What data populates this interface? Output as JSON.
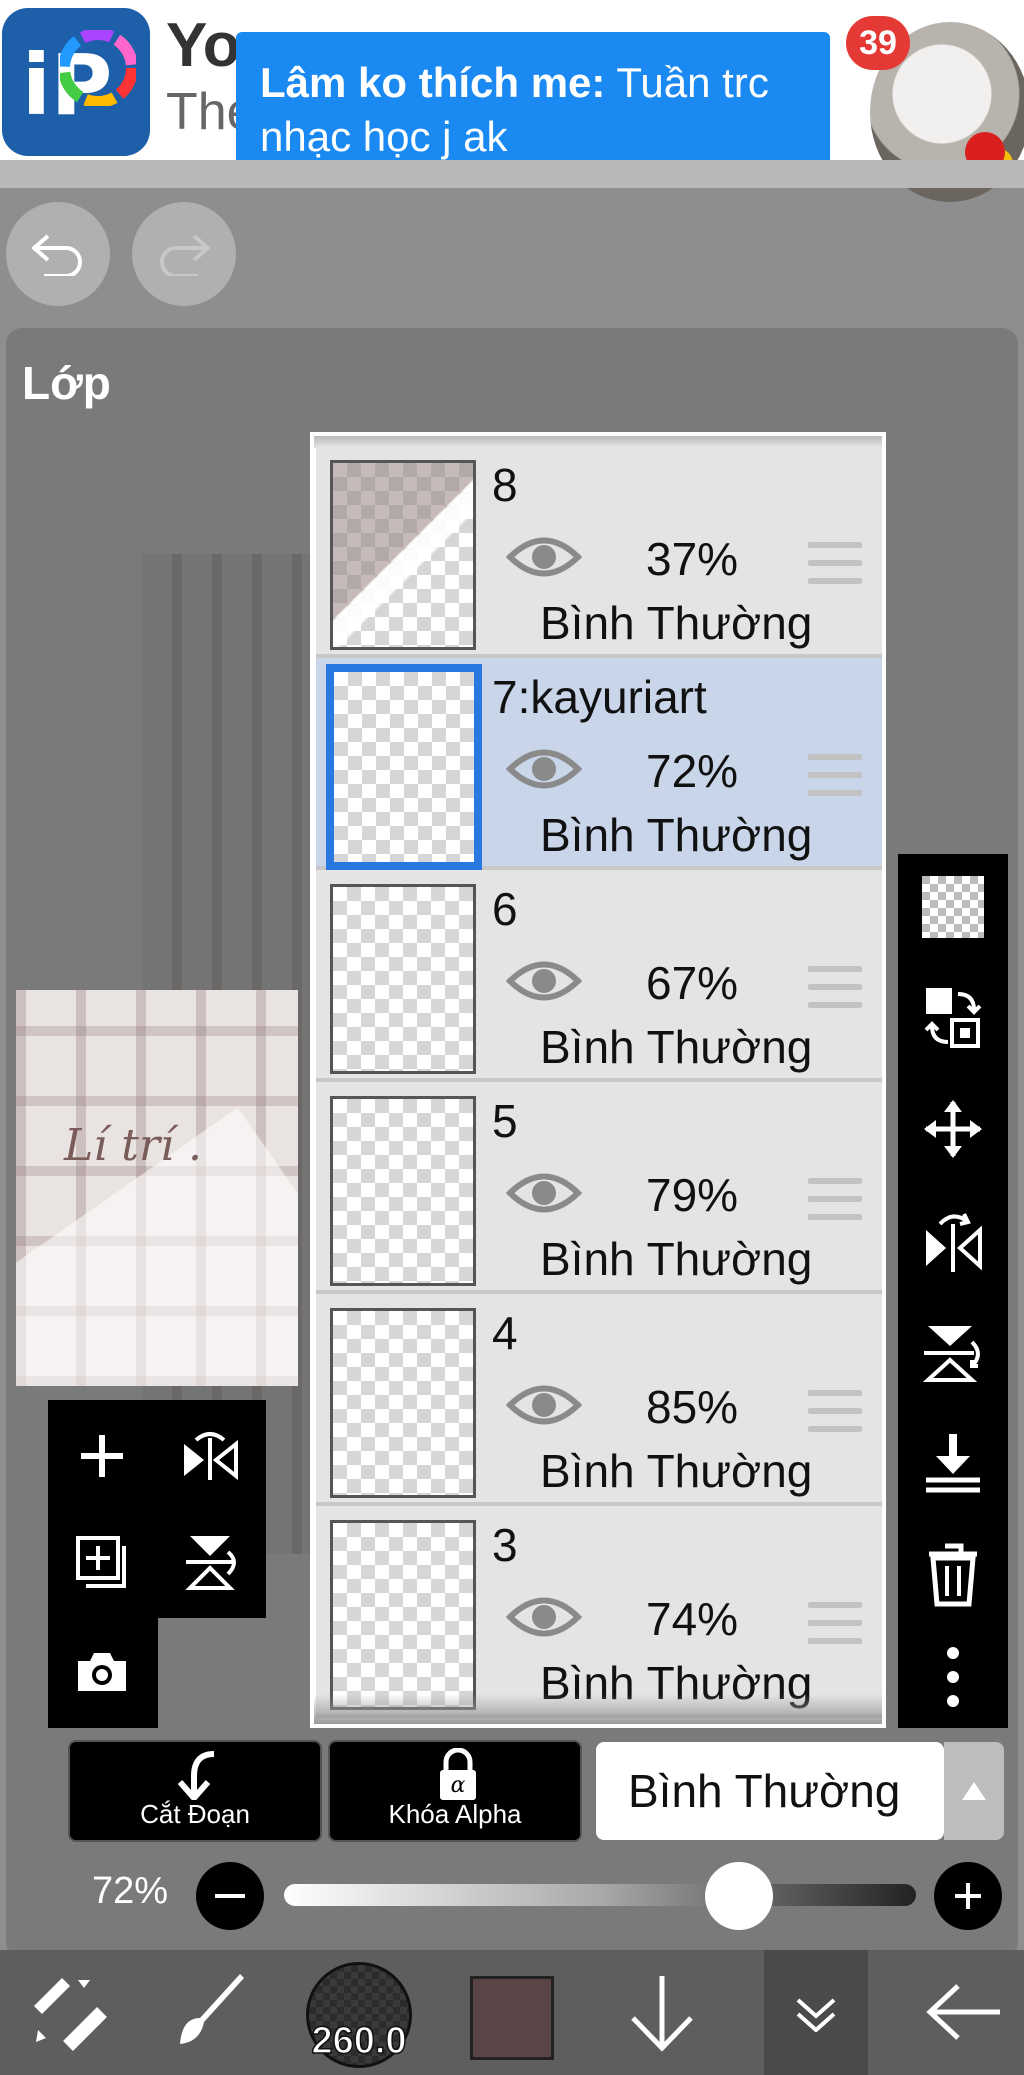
{
  "status_notification": {
    "sender": "Lâm ko thích me:",
    "message": "Tuần trc nhạc học j ak",
    "badge_count": "39"
  },
  "app_header": {
    "title": "Yo",
    "subtitle": "The"
  },
  "panel": {
    "title": "Lớp"
  },
  "layers": [
    {
      "name": "8",
      "opacity": "37%",
      "blend_mode": "Bình Thường",
      "selected": false
    },
    {
      "name": "7:kayuriart",
      "opacity": "72%",
      "blend_mode": "Bình Thường",
      "selected": true
    },
    {
      "name": "6",
      "opacity": "67%",
      "blend_mode": "Bình Thường",
      "selected": false
    },
    {
      "name": "5",
      "opacity": "79%",
      "blend_mode": "Bình Thường",
      "selected": false
    },
    {
      "name": "4",
      "opacity": "85%",
      "blend_mode": "Bình Thường",
      "selected": false
    },
    {
      "name": "3",
      "opacity": "74%",
      "blend_mode": "Bình Thường",
      "selected": false
    }
  ],
  "preview_text": "Lí trí .",
  "layer_actions": {
    "clipping_label": "Cắt Đoạn",
    "alpha_lock_label": "Khóa Alpha",
    "blend_mode_value": "Bình Thường"
  },
  "opacity": {
    "label": "72%",
    "value": 0.72
  },
  "bottom_bar": {
    "brush_size": "260.0",
    "color": "#5a4646"
  },
  "colors": {
    "notification_blue": "#1a8af2",
    "selected_layer": "#c9d6ea",
    "selected_border": "#2878e0",
    "badge_red": "#e53935"
  }
}
